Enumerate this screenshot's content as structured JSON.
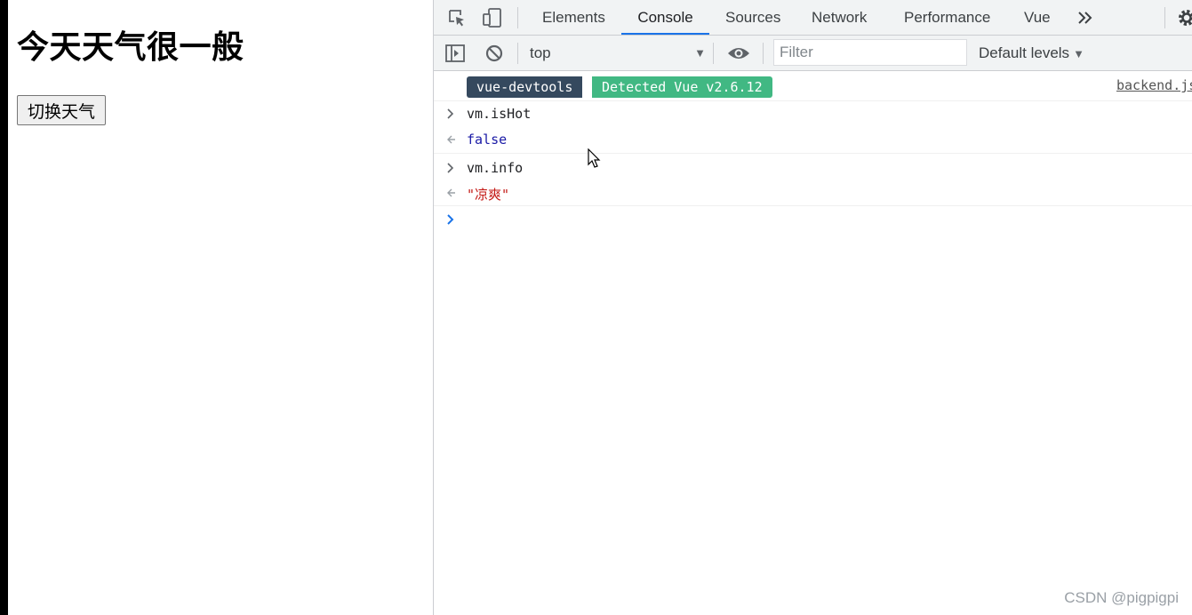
{
  "page": {
    "heading": "今天天气很一般",
    "toggle_button": "切换天气"
  },
  "devtools": {
    "tabs": [
      "Elements",
      "Console",
      "Sources",
      "Network",
      "Performance",
      "Vue"
    ],
    "active_tab": "Console",
    "toolbar": {
      "context": "top",
      "filter_placeholder": "Filter",
      "filter_value": "",
      "levels": "Default levels"
    },
    "console": {
      "badge": {
        "tool": "vue-devtools",
        "message": "Detected Vue v2.6.12",
        "source": "backend.js"
      },
      "entries": [
        {
          "input": "vm.isHot",
          "output": "false",
          "output_type": "boolean"
        },
        {
          "input": "vm.info",
          "output": "\"凉爽\"",
          "output_type": "string"
        }
      ]
    }
  },
  "watermark": "CSDN @pigpigpi",
  "colors": {
    "vue_dark": "#35495e",
    "vue_green": "#41b883",
    "active_tab_underline": "#1a73e8",
    "boolean": "#1a1aa6",
    "string": "#c41a16"
  },
  "icons": [
    "inspect-icon",
    "device-toggle-icon",
    "more-tabs-icon",
    "settings-gear-icon",
    "sidebar-toggle-icon",
    "clear-console-icon",
    "eye-icon",
    "input-chevron-icon",
    "return-arrow-icon",
    "prompt-chevron-icon",
    "mouse-cursor-icon"
  ]
}
